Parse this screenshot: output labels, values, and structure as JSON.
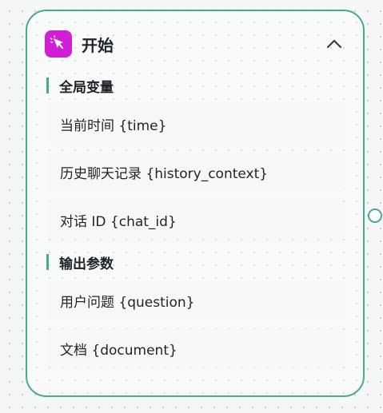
{
  "node": {
    "title": "开始",
    "icon": "cursor-click-icon",
    "accent_color": "#4aa98d",
    "icon_bg_color": "#d21fd6",
    "collapse_icon": "chevron-up-icon"
  },
  "sections": {
    "global_vars": {
      "title": "全局变量",
      "items": [
        {
          "label": "当前时间 {time}"
        },
        {
          "label": "历史聊天记录 {history_context}"
        },
        {
          "label": "对话 ID {chat_id}"
        }
      ]
    },
    "output_params": {
      "title": "输出参数",
      "items": [
        {
          "label": "用户问题 {question}"
        },
        {
          "label": "文档 {document}"
        }
      ]
    }
  }
}
